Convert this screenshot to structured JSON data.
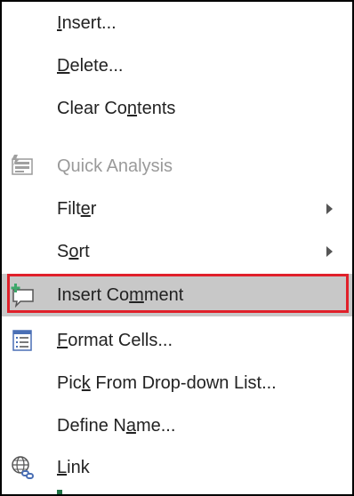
{
  "context_menu": {
    "items": [
      {
        "pre": "",
        "key": "I",
        "post": "nsert..."
      },
      {
        "pre": "",
        "key": "D",
        "post": "elete..."
      },
      {
        "pre": "Clear Co",
        "key": "n",
        "post": "tents"
      },
      {
        "pre": "Quick Analysis",
        "key": "",
        "post": "",
        "disabled": true,
        "icon": "quick-analysis-icon"
      },
      {
        "pre": "Filt",
        "key": "e",
        "post": "r",
        "submenu": true
      },
      {
        "pre": "S",
        "key": "o",
        "post": "rt",
        "submenu": true
      },
      {
        "pre": "Insert Co",
        "key": "m",
        "post": "ment",
        "highlighted": true,
        "icon": "insert-comment-icon"
      },
      {
        "pre": "",
        "key": "F",
        "post": "ormat Cells...",
        "icon": "format-cells-icon"
      },
      {
        "pre": "Pic",
        "key": "k",
        "post": " From Drop-down List..."
      },
      {
        "pre": "Define N",
        "key": "a",
        "post": "me..."
      },
      {
        "pre": "",
        "key": "L",
        "post": "ink",
        "icon": "link-icon"
      }
    ],
    "highlight_color": "#e0202a"
  }
}
